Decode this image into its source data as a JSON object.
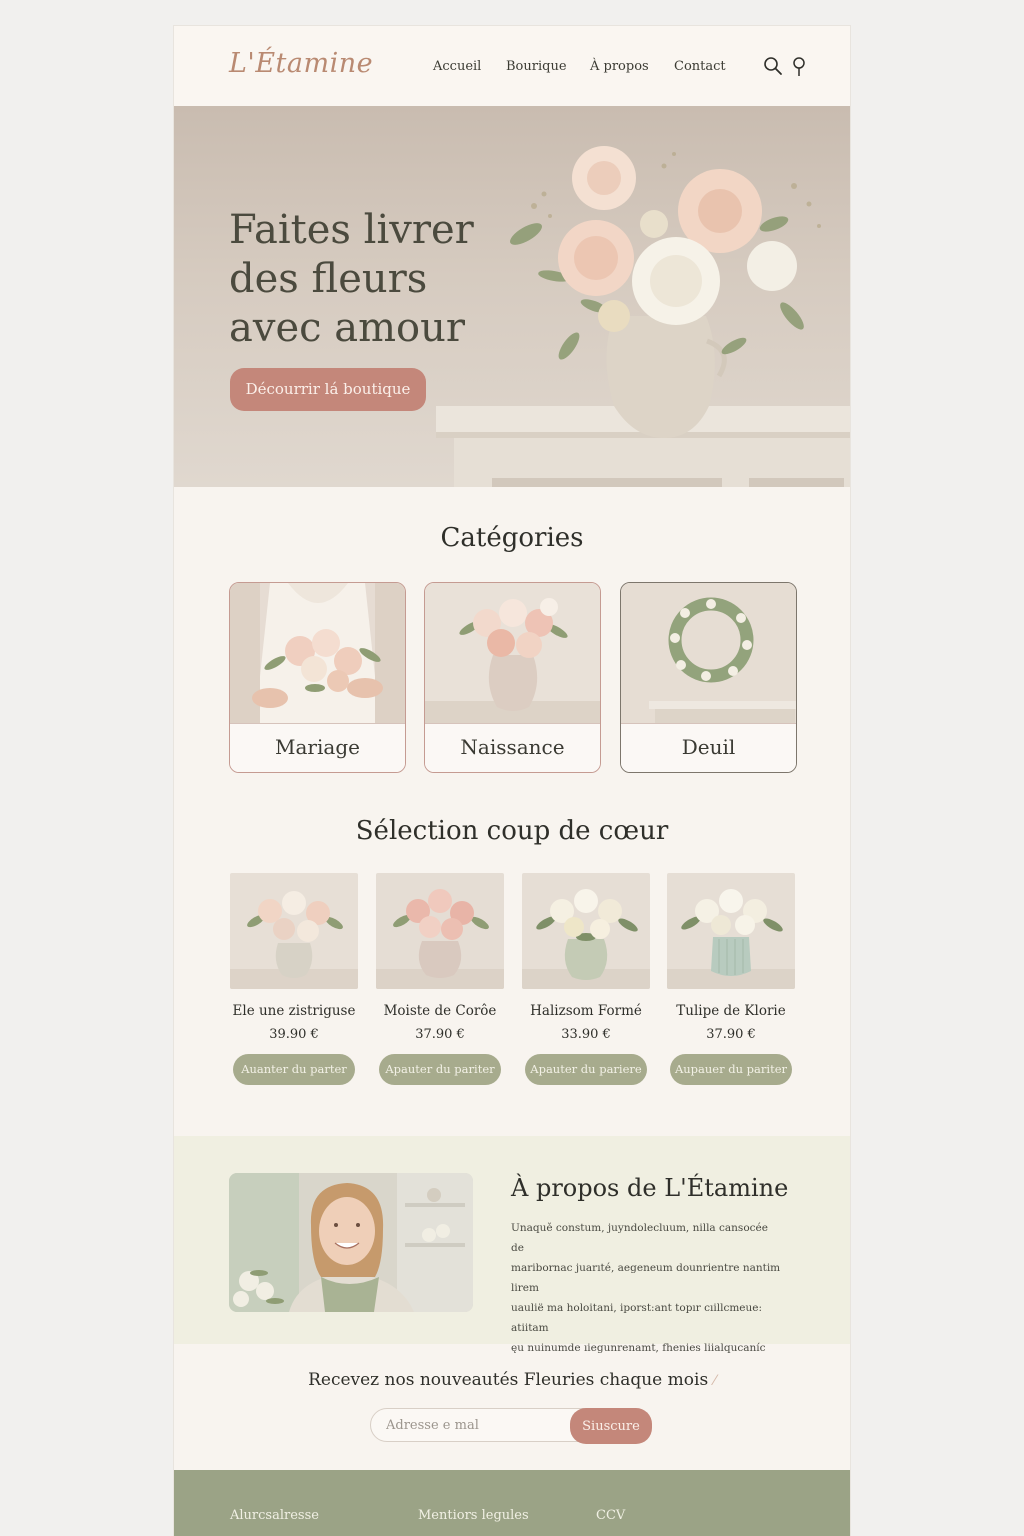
{
  "header": {
    "logo": "L'Étamine",
    "nav": [
      "Accueil",
      "Bourique",
      "À propos",
      "Contact"
    ],
    "icons": [
      "search-icon",
      "location-pin-icon"
    ]
  },
  "hero": {
    "title": "Faites livrer\ndes fleurs\navec amour",
    "cta": "Décourrir lá boutique"
  },
  "categories": {
    "title": "Catégories",
    "items": [
      {
        "label": "Mariage"
      },
      {
        "label": "Naissance"
      },
      {
        "label": "Deuil"
      }
    ]
  },
  "selection": {
    "title": "Sélection coup de cœur",
    "products": [
      {
        "name": "Ele une zistriguse",
        "price": "39.90 €",
        "button": "Auanter du parter"
      },
      {
        "name": "Moiste de Corôe",
        "price": "37.90 €",
        "button": "Apauter du pariter"
      },
      {
        "name": "Halizsom Formé",
        "price": "33.90 €",
        "button": "Apauter du pariere"
      },
      {
        "name": "Tulipe de Klorie",
        "price": "37.90 €",
        "button": "Aupauer du pariter"
      }
    ]
  },
  "about": {
    "title": "À propos de L'Étamine",
    "text": "Unaquě constum, juyndolecluum, nilla cansocée de\nmaribornac juarıté, aegeneum dounrientre nantim lirem\nuaulië ma holoitani, iporst:ant topır cıillcmeue: atiitam\nęu nuinumde ıiegunrenamt, fhenies liialqucaníc"
  },
  "newsletter": {
    "title": "Recevez nos nouveautés Fleuries chaque mois",
    "placeholder": "Adresse e mal",
    "button": "Siuscure"
  },
  "footer": {
    "links": [
      "Alurcsalresse",
      "Mentiors legules",
      "CCV"
    ]
  },
  "colors": {
    "accent": "#c4877a",
    "sage": "#a7ab8d",
    "footer": "#9ba386",
    "background": "#f8f4ef"
  }
}
